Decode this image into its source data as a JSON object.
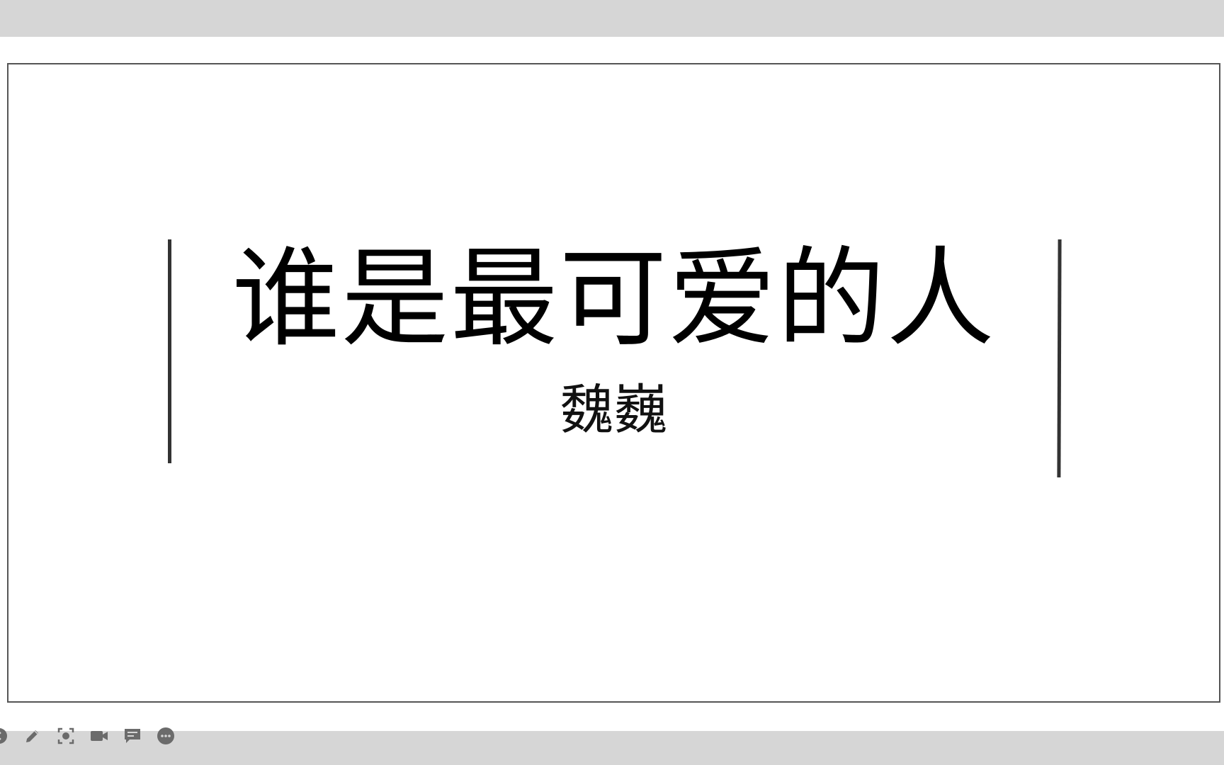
{
  "slide": {
    "title": "谁是最可爱的人",
    "subtitle": "魏巍"
  },
  "toolbar": {
    "icons": [
      "previous-icon",
      "pen-icon",
      "focus-icon",
      "video-icon",
      "comment-icon",
      "more-icon"
    ]
  },
  "colors": {
    "chrome": "#d6d6d6",
    "slide_border": "#555555",
    "text": "#000000",
    "icon": "#6b6b6b"
  }
}
